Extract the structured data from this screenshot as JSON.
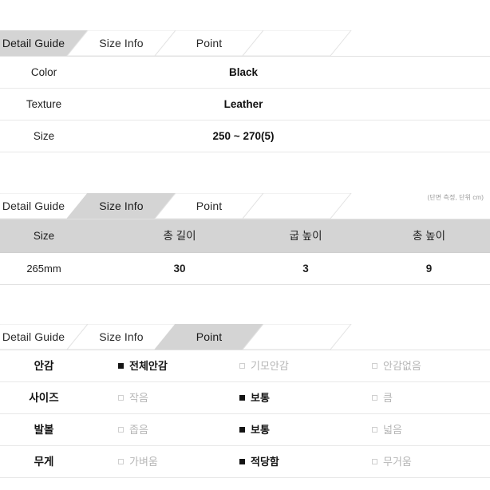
{
  "theme": {
    "active_tab_bg": "#d4d4d4",
    "inactive_tab_bg": "#ffffff",
    "header_row_bg": "#d4d4d4",
    "row_border": "#e8e8e8",
    "checked_color": "#141414",
    "unchecked_color": "#b6b6b6",
    "page_bg": "#ffffff"
  },
  "tabs": [
    {
      "id": "detail-guide",
      "label": "Detail Guide"
    },
    {
      "id": "size-info",
      "label": "Size Info"
    },
    {
      "id": "point",
      "label": "Point"
    }
  ],
  "sections": [
    {
      "id": "detail-guide-section",
      "active_tab": "Detail Guide",
      "active_index": 0,
      "rows": [
        {
          "label": "Color",
          "value": "Black"
        },
        {
          "label": "Texture",
          "value": "Leather"
        },
        {
          "label": "Size",
          "value": "250 ~ 270(5)"
        }
      ]
    },
    {
      "id": "size-info-section",
      "active_tab": "Size Info",
      "active_index": 1,
      "unit_note": "(단면 측정, 단위 cm)",
      "columns": [
        "Size",
        "총 길이",
        "굽 높이",
        "총 높이"
      ],
      "rows": [
        [
          "265mm",
          "30",
          "3",
          "9"
        ]
      ]
    },
    {
      "id": "point-section",
      "active_tab": "Point",
      "active_index": 2,
      "rows": [
        {
          "label": "안감",
          "options": [
            {
              "text": "전체안감",
              "checked": true
            },
            {
              "text": "기모안감",
              "checked": false
            },
            {
              "text": "안감없음",
              "checked": false
            }
          ]
        },
        {
          "label": "사이즈",
          "options": [
            {
              "text": "작음",
              "checked": false
            },
            {
              "text": "보통",
              "checked": true
            },
            {
              "text": "큼",
              "checked": false
            }
          ]
        },
        {
          "label": "발볼",
          "options": [
            {
              "text": "좁음",
              "checked": false
            },
            {
              "text": "보통",
              "checked": true
            },
            {
              "text": "넓음",
              "checked": false
            }
          ]
        },
        {
          "label": "무게",
          "options": [
            {
              "text": "가벼움",
              "checked": false
            },
            {
              "text": "적당함",
              "checked": true
            },
            {
              "text": "무거움",
              "checked": false
            }
          ]
        }
      ]
    }
  ]
}
